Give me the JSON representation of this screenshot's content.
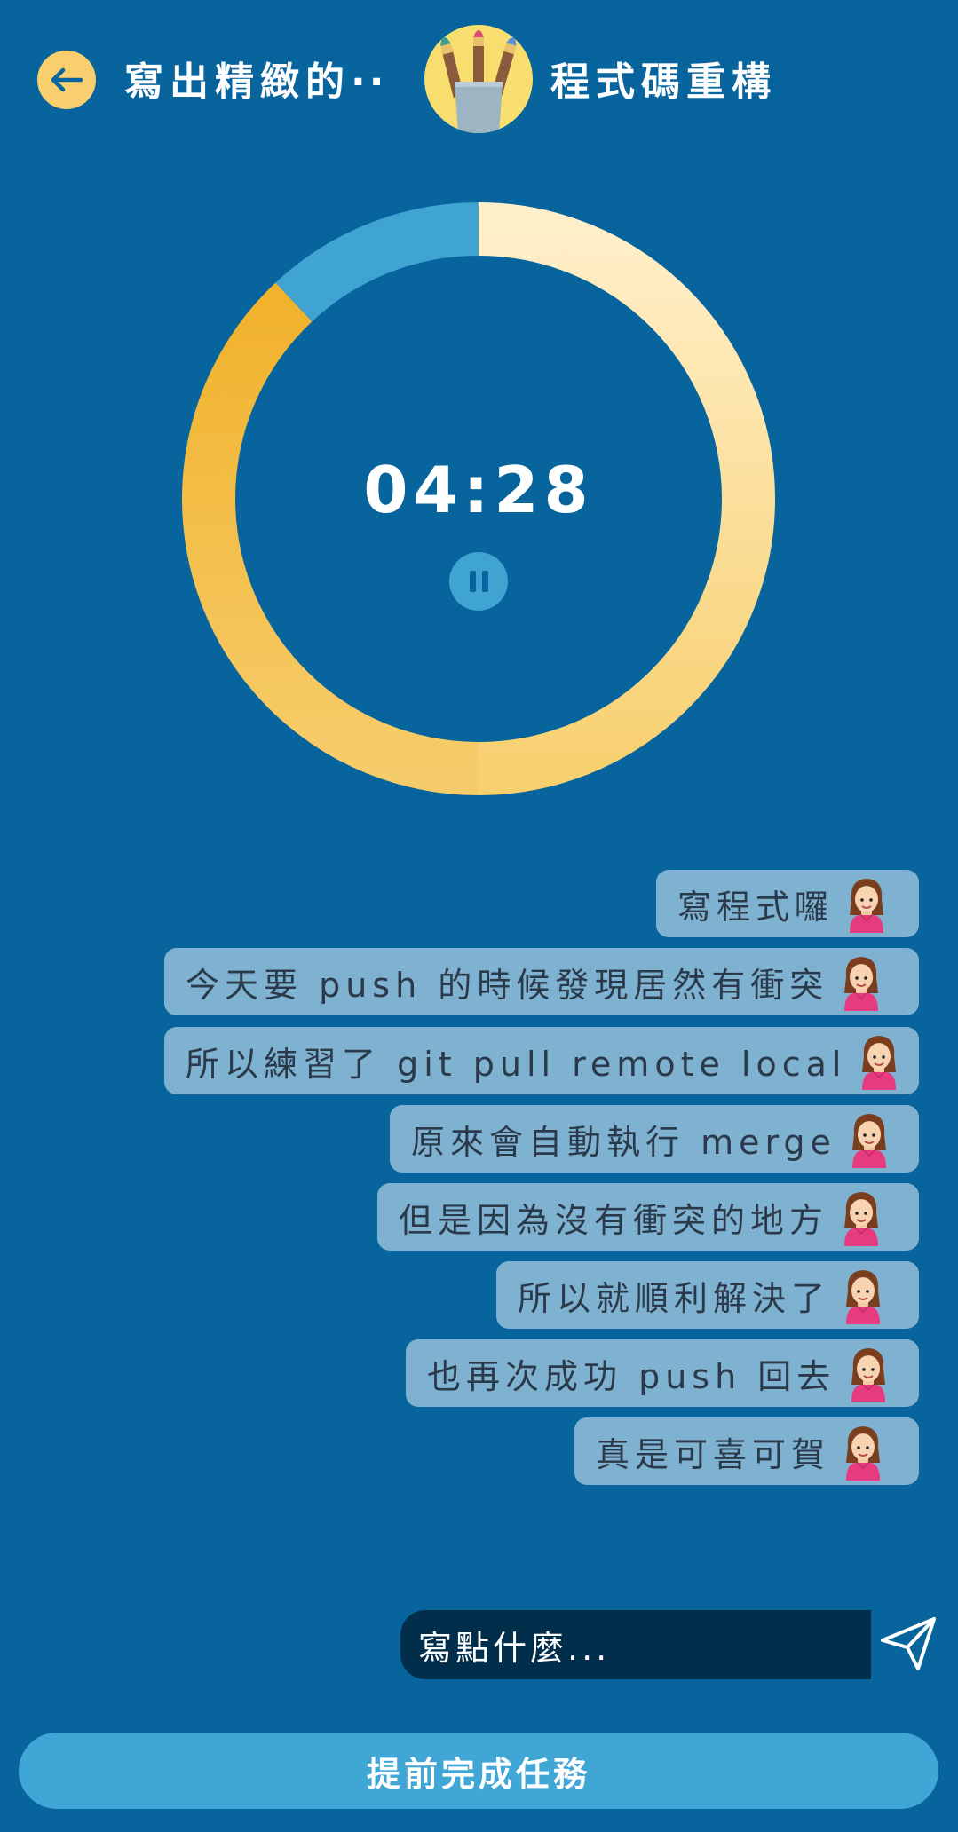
{
  "header": {
    "back_icon": "arrow-left-icon",
    "title_left": "寫出精緻的",
    "title_ellipsis": "··",
    "logo_icon": "paintbrush-cup-icon",
    "title_right": "程式碼重構"
  },
  "timer": {
    "time": "04:28",
    "pause_icon": "pause-icon",
    "elapsed_fraction": 0.12,
    "colors": {
      "remaining_light": "#FFEFC9",
      "remaining_dark": "#F2B52F",
      "elapsed": "#3FA4D2"
    }
  },
  "messages": [
    {
      "text": "寫程式囉",
      "avatar": "girl-avatar-icon"
    },
    {
      "text": "今天要 push 的時候發現居然有衝突",
      "avatar": "girl-avatar-icon"
    },
    {
      "text": "所以練習了 git pull remote local",
      "avatar": "girl-avatar-icon"
    },
    {
      "text": "原來會自動執行 merge",
      "avatar": "girl-avatar-icon"
    },
    {
      "text": "但是因為沒有衝突的地方",
      "avatar": "girl-avatar-icon"
    },
    {
      "text": "所以就順利解決了",
      "avatar": "girl-avatar-icon"
    },
    {
      "text": "也再次成功 push 回去",
      "avatar": "girl-avatar-icon"
    },
    {
      "text": "真是可喜可賀",
      "avatar": "girl-avatar-icon"
    }
  ],
  "composer": {
    "placeholder": "寫點什麼...",
    "send_icon": "paper-plane-icon"
  },
  "finish_button": {
    "label": "提前完成任務"
  },
  "colors": {
    "background": "#07649D",
    "accent": "#F8CE6E",
    "bubble": "#7FB2D1",
    "button": "#40A6D5",
    "input": "#012E4A"
  }
}
